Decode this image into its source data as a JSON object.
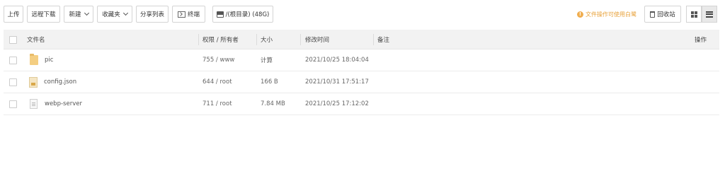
{
  "toolbar": {
    "upload": "上传",
    "remote_download": "远程下载",
    "new": "新建",
    "favorites": "收藏夹",
    "share_list": "分享列表",
    "terminal": "终端",
    "disk": "/(根目录) (48G)",
    "warning": "文件操作可使用白鹭",
    "recycle_bin": "回收站"
  },
  "table": {
    "headers": {
      "name": "文件名",
      "perm_owner": "权限 / 所有者",
      "size": "大小",
      "mtime": "修改时间",
      "remark": "备注",
      "action": "操作"
    },
    "rows": [
      {
        "type": "folder",
        "name": "pic",
        "perm": "755 / www",
        "size": "计算",
        "mtime": "2021/10/25 18:04:04",
        "remark": ""
      },
      {
        "type": "json",
        "name": "config.json",
        "perm": "644 / root",
        "size": "166 B",
        "mtime": "2021/10/31 17:51:17",
        "remark": ""
      },
      {
        "type": "file",
        "name": "webp-server",
        "perm": "711 / root",
        "size": "7.84 MB",
        "mtime": "2021/10/25 17:12:02",
        "remark": ""
      }
    ]
  },
  "colors": {
    "accent_warning": "#e8a33d",
    "folder": "#f4ce82",
    "header_bg": "#f2f2f2"
  }
}
